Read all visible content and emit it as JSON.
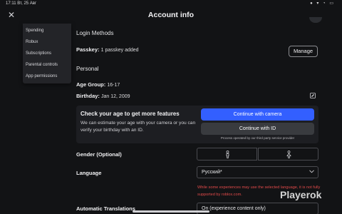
{
  "statusbar": {
    "time": "17:11 Вт, 25 Авг",
    "icons": "● ▾ ◔ ▭"
  },
  "header": {
    "title": "Account info",
    "close_icon": "close-icon"
  },
  "menu": {
    "items": [
      {
        "label": "Spending"
      },
      {
        "label": "Robux"
      },
      {
        "label": "Subscriptions"
      },
      {
        "label": "Parental controls"
      },
      {
        "label": "App permissions"
      }
    ]
  },
  "login": {
    "heading": "Login Methods",
    "passkey_label": "Passkey:",
    "passkey_value": "1 passkey added",
    "manage_label": "Manage"
  },
  "personal": {
    "heading": "Personal",
    "age_group_label": "Age Group:",
    "age_group_value": "16-17",
    "birthday_label": "Birthday:",
    "birthday_value": "Jan 12, 2009"
  },
  "age_check": {
    "title": "Check your age to get more features",
    "description": "We can estimate your age with your camera or you can verify your birthday with an ID.",
    "camera_button": "Continue with camera",
    "id_button": "Continue with ID",
    "note": "Process operated by our third party service provider"
  },
  "gender": {
    "label": "Gender (Optional)"
  },
  "language": {
    "label": "Language",
    "selected": "Русский*",
    "warning": "While some experiences may use the selected language, it is not fully supported by roblox.com."
  },
  "translations": {
    "label": "Automatic Translations",
    "selected": "On (experience content only)"
  },
  "watermark": "Playerok",
  "colors": {
    "accent": "#335fff",
    "warning": "#e24a4a",
    "background": "#121315"
  }
}
